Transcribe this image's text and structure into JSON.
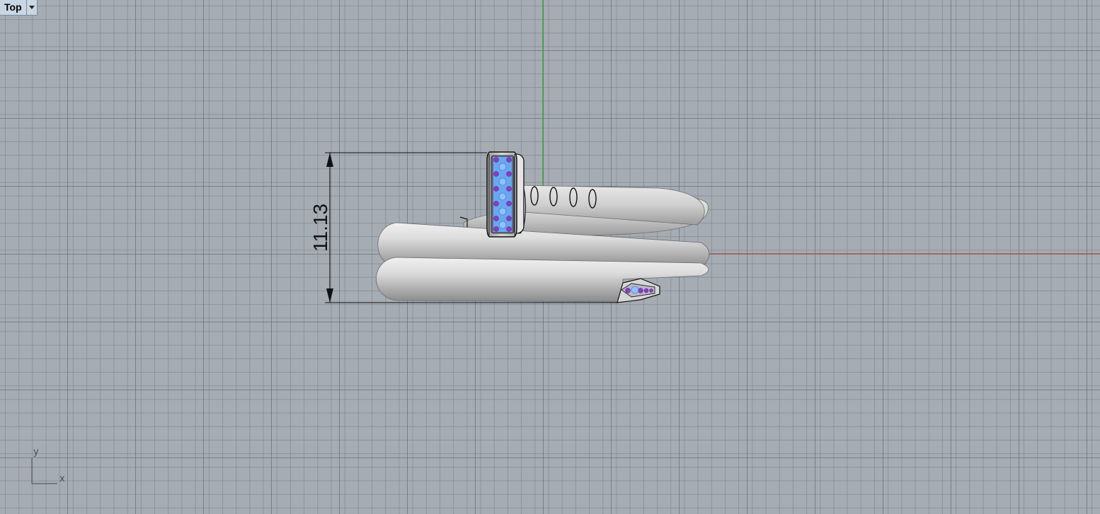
{
  "viewport": {
    "title": "Top",
    "menu_icon": "chevron-down-icon"
  },
  "dimension": {
    "value": "11.13"
  },
  "axes_icon": {
    "x_label": "x",
    "y_label": "y"
  },
  "colors": {
    "background": "#a5acb3",
    "x_axis": "#b04b43",
    "y_axis": "#2aa02a",
    "metal": "#c9c9c9",
    "gem_blue": "#6aa7f2",
    "gem_purple": "#8a3cc0"
  }
}
